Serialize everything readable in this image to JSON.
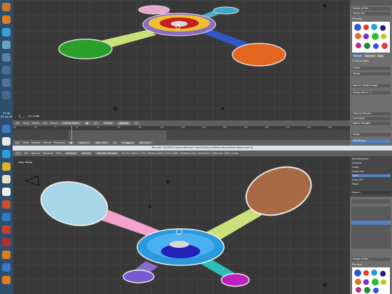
{
  "taskbar": {
    "clock_time": "23:38",
    "clock_date": "09.04.2016"
  },
  "top_view": {
    "object_label": "(1) Cube",
    "header": {
      "view": "View",
      "select": "Select",
      "add": "Add",
      "object": "Object",
      "mode": "Object Mode",
      "orientation": "Global"
    }
  },
  "timeline": {
    "header": {
      "view": "View",
      "marker": "Marker",
      "frame": "Frame",
      "playback": "Playback",
      "start_label": "Start:",
      "start_value": "1",
      "end_label": "End:",
      "end_value": "250",
      "current_frame": "1",
      "sync": "No Sync"
    },
    "ticks": [
      "-40",
      "-20",
      "0",
      "20",
      "40",
      "60",
      "80",
      "100",
      "120",
      "140",
      "160",
      "180",
      "200",
      "220",
      "240",
      "260"
    ]
  },
  "window": {
    "title": "Blender* [D:\\KGP\\Lektion\\Blender Files\\ZwillbrunnRettunBase\\RettunBase.blend]",
    "menu": {
      "file": "File",
      "render": "Render",
      "window": "Window",
      "help": "Help",
      "layout": "Default",
      "scene": "Scene",
      "engine": "Blender Render",
      "stats": "v2.76 | Verts:1,792 | Faces:1,802 | Tris:3,584 | Objects:1/8 | Lamps:0/1 | Mem:41.24M | Cube"
    }
  },
  "bottom_view": {
    "label": "User Persp"
  },
  "properties_top": {
    "tabs": [
      "Texture",
      "Material",
      "Data"
    ],
    "preview_label": "Preview",
    "image_name": "image.tex",
    "rows": [
      "Image or Mo...",
      "Colors",
      "Image",
      "Source:  Single Image",
      "Image.inst 1, +...",
      "View as Render",
      "Use Alpha",
      "Alpha:  Straight",
      "Fields",
      "Interlacing"
    ],
    "preview_tab": "Image"
  },
  "right_bottom": {
    "outliner": [
      "RenderLayers",
      "Camera",
      "Lamp",
      "Lamp.001",
      "Cube",
      "Cube.001",
      "Plane"
    ],
    "search": "Search"
  },
  "colors": {
    "viewport_bg": "#393939",
    "header_bg": "#5f5f5f",
    "accent_blue": "#5680c2",
    "taskbar_bg": "#2c4f6e"
  }
}
